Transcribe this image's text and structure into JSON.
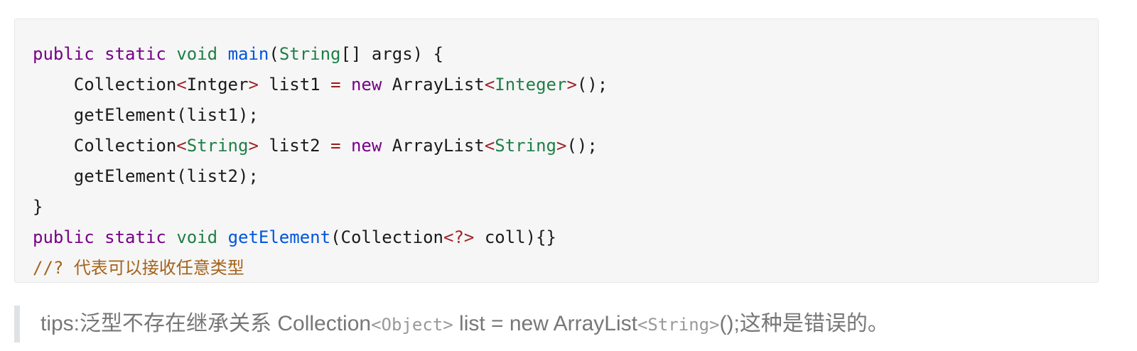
{
  "code_block": {
    "lines": [
      [
        {
          "t": "public",
          "c": "kw"
        },
        {
          "t": " "
        },
        {
          "t": "static",
          "c": "kw"
        },
        {
          "t": " "
        },
        {
          "t": "void",
          "c": "ty"
        },
        {
          "t": " "
        },
        {
          "t": "main",
          "c": "fn"
        },
        {
          "t": "("
        },
        {
          "t": "String",
          "c": "ty"
        },
        {
          "t": "[] args) {"
        }
      ],
      [
        {
          "t": "    Collection"
        },
        {
          "t": "<",
          "c": "tag"
        },
        {
          "t": "Intger"
        },
        {
          "t": ">",
          "c": "tag"
        },
        {
          "t": " list1 "
        },
        {
          "t": "=",
          "c": "op"
        },
        {
          "t": " "
        },
        {
          "t": "new",
          "c": "kw"
        },
        {
          "t": " ArrayList"
        },
        {
          "t": "<",
          "c": "tag"
        },
        {
          "t": "Integer",
          "c": "ty"
        },
        {
          "t": ">",
          "c": "tag"
        },
        {
          "t": "();"
        }
      ],
      [
        {
          "t": "    getElement(list1);"
        }
      ],
      [
        {
          "t": "    Collection"
        },
        {
          "t": "<",
          "c": "tag"
        },
        {
          "t": "String",
          "c": "ty"
        },
        {
          "t": ">",
          "c": "tag"
        },
        {
          "t": " list2 "
        },
        {
          "t": "=",
          "c": "op"
        },
        {
          "t": " "
        },
        {
          "t": "new",
          "c": "kw"
        },
        {
          "t": " ArrayList"
        },
        {
          "t": "<",
          "c": "tag"
        },
        {
          "t": "String",
          "c": "ty"
        },
        {
          "t": ">",
          "c": "tag"
        },
        {
          "t": "();"
        }
      ],
      [
        {
          "t": "    getElement(list2);"
        }
      ],
      [
        {
          "t": "}"
        }
      ],
      [
        {
          "t": "public",
          "c": "kw"
        },
        {
          "t": " "
        },
        {
          "t": "static",
          "c": "kw"
        },
        {
          "t": " "
        },
        {
          "t": "void",
          "c": "ty"
        },
        {
          "t": " "
        },
        {
          "t": "getElement",
          "c": "fn"
        },
        {
          "t": "(Collection"
        },
        {
          "t": "<?>",
          "c": "tag"
        },
        {
          "t": " coll){}"
        }
      ],
      [
        {
          "t": "//? 代表可以接收任意类型",
          "c": "cm"
        }
      ]
    ]
  },
  "tip": {
    "text_before": "tips:泛型不存在继承关系 Collection",
    "code_1": "<Object>",
    "text_middle": " list = new ArrayList",
    "code_2": "<String>",
    "text_after": "();这种是错误的。"
  },
  "colors": {
    "keyword": "#770088",
    "type": "#1f7f47",
    "function": "#0055dd",
    "bracket": "#a0222a",
    "operator": "#981a1a",
    "comment": "#a4631b",
    "code_background": "#f6f6f6",
    "quote_bar": "#dfe2e5",
    "quote_text": "#777777"
  }
}
